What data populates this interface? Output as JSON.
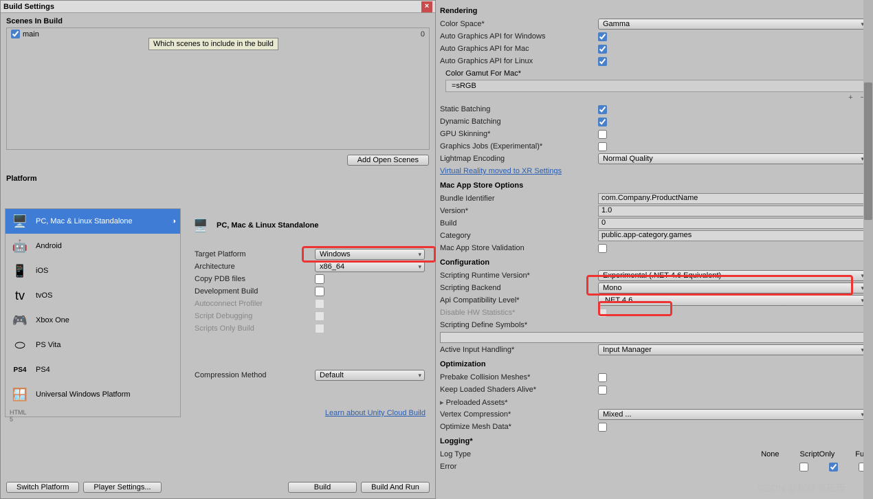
{
  "window": {
    "title": "Build Settings"
  },
  "scenes": {
    "heading": "Scenes In Build",
    "tooltip": "Which scenes to include in the build",
    "items": [
      {
        "name": "main",
        "index": "0",
        "checked": true
      }
    ],
    "add_button": "Add Open Scenes"
  },
  "platform": {
    "heading": "Platform",
    "items": [
      {
        "label": "PC, Mac & Linux Standalone",
        "selected": true,
        "icon": "🖥️"
      },
      {
        "label": "Android",
        "icon": "🤖"
      },
      {
        "label": "iOS",
        "icon": "📱"
      },
      {
        "label": "tvOS",
        "icon": "📺"
      },
      {
        "label": "Xbox One",
        "icon": "🎮"
      },
      {
        "label": "PS Vita",
        "icon": "🎮"
      },
      {
        "label": "PS4",
        "icon": "PS4"
      },
      {
        "label": "Universal Windows Platform",
        "icon": "🪟"
      }
    ]
  },
  "settings": {
    "header": "PC, Mac & Linux Standalone",
    "target_platform": {
      "label": "Target Platform",
      "value": "Windows"
    },
    "architecture": {
      "label": "Architecture",
      "value": "x86_64"
    },
    "copy_pdb": {
      "label": "Copy PDB files"
    },
    "dev_build": {
      "label": "Development Build"
    },
    "autoconnect": {
      "label": "Autoconnect Profiler"
    },
    "script_debug": {
      "label": "Script Debugging"
    },
    "scripts_only": {
      "label": "Scripts Only Build"
    },
    "compression": {
      "label": "Compression Method",
      "value": "Default"
    },
    "cloud_link": "Learn about Unity Cloud Build"
  },
  "buttons": {
    "switch_platform": "Switch Platform",
    "player_settings": "Player Settings...",
    "build": "Build",
    "build_run": "Build And Run"
  },
  "inspector": {
    "rendering": {
      "heading": "Rendering",
      "color_space": {
        "label": "Color Space*",
        "value": "Gamma"
      },
      "auto_win": {
        "label": "Auto Graphics API for Windows",
        "checked": true
      },
      "auto_mac": {
        "label": "Auto Graphics API for Mac",
        "checked": true
      },
      "auto_linux": {
        "label": "Auto Graphics API for Linux",
        "checked": true
      },
      "color_gamut": {
        "label": "Color Gamut For Mac*",
        "value": "sRGB"
      },
      "static_batch": {
        "label": "Static Batching",
        "checked": true
      },
      "dynamic_batch": {
        "label": "Dynamic Batching",
        "checked": true
      },
      "gpu_skin": {
        "label": "GPU Skinning*",
        "checked": false
      },
      "graphics_jobs": {
        "label": "Graphics Jobs (Experimental)*",
        "checked": false
      },
      "lightmap": {
        "label": "Lightmap Encoding",
        "value": "Normal Quality"
      },
      "vr_link": "Virtual Reality moved to XR Settings"
    },
    "macstore": {
      "heading": "Mac App Store Options",
      "bundle": {
        "label": "Bundle Identifier",
        "value": "com.Company.ProductName"
      },
      "version": {
        "label": "Version*",
        "value": "1.0"
      },
      "build": {
        "label": "Build",
        "value": "0"
      },
      "category": {
        "label": "Category",
        "value": "public.app-category.games"
      },
      "validation": {
        "label": "Mac App Store Validation",
        "checked": false
      }
    },
    "config": {
      "heading": "Configuration",
      "runtime": {
        "label": "Scripting Runtime Version*",
        "value": "Experimental (.NET 4.6 Equivalent)"
      },
      "backend": {
        "label": "Scripting Backend",
        "value": "Mono"
      },
      "api_level": {
        "label": "Api Compatibility Level*",
        "value": ".NET 4.6"
      },
      "disable_hw": {
        "label": "Disable HW Statistics*",
        "checked": false
      },
      "define_symbols": {
        "label": "Scripting Define Symbols*"
      },
      "input": {
        "label": "Active Input Handling*",
        "value": "Input Manager"
      }
    },
    "optimization": {
      "heading": "Optimization",
      "prebake": {
        "label": "Prebake Collision Meshes*",
        "checked": false
      },
      "shaders": {
        "label": "Keep Loaded Shaders Alive*",
        "checked": false
      },
      "preloaded": {
        "label": "Preloaded Assets*"
      },
      "vertex": {
        "label": "Vertex Compression*",
        "value": "Mixed ..."
      },
      "optimize_mesh": {
        "label": "Optimize Mesh Data*",
        "checked": false
      }
    },
    "logging": {
      "heading": "Logging*",
      "col1": "None",
      "col2": "ScriptOnly",
      "col3": "Full",
      "row1": "Log Type",
      "row2": "Error"
    }
  },
  "watermark": "CSDN @程序员正茂"
}
